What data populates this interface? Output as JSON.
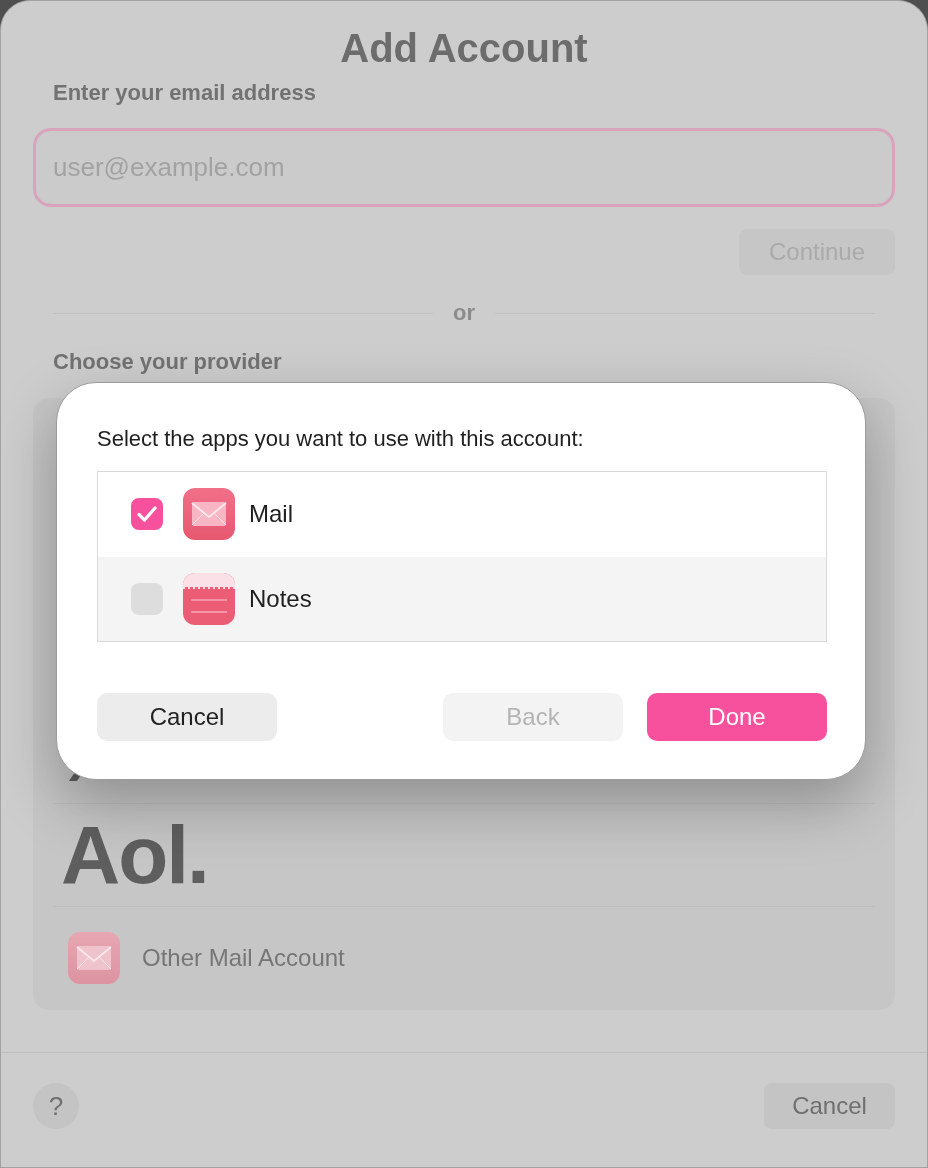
{
  "window": {
    "title": "Add Account"
  },
  "email": {
    "label": "Enter your email address",
    "placeholder": "user@example.com",
    "continue_button": {
      "label": "Continue",
      "disabled": true
    }
  },
  "separator": "or",
  "providers": {
    "label": "Choose your provider",
    "items": [
      {
        "kind": "logo",
        "label": "Aol."
      },
      {
        "kind": "app",
        "label": "Other Mail Account"
      }
    ]
  },
  "footer": {
    "help": "?",
    "cancel": "Cancel"
  },
  "dialog": {
    "prompt": "Select the apps you want to use with this account:",
    "apps": [
      {
        "name": "Mail",
        "kind": "mail",
        "checked": true
      },
      {
        "name": "Notes",
        "kind": "notes",
        "checked": false
      }
    ],
    "buttons": [
      {
        "label": "Cancel",
        "kind": "secondary",
        "disabled": false
      },
      {
        "label": "Back",
        "kind": "secondary",
        "disabled": true
      },
      {
        "label": "Done",
        "kind": "primary",
        "disabled": false
      }
    ]
  }
}
